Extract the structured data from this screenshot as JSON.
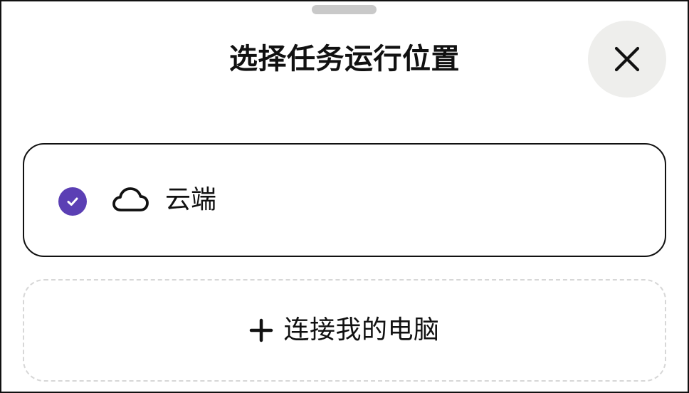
{
  "dialog": {
    "title": "选择任务运行位置",
    "close_icon": "close-icon",
    "accent_color": "#5b3fb4"
  },
  "options": [
    {
      "label": "云端",
      "selected": true,
      "icon": "cloud-icon"
    }
  ],
  "connect_button": {
    "label": "连接我的电脑",
    "icon": "plus-icon"
  }
}
